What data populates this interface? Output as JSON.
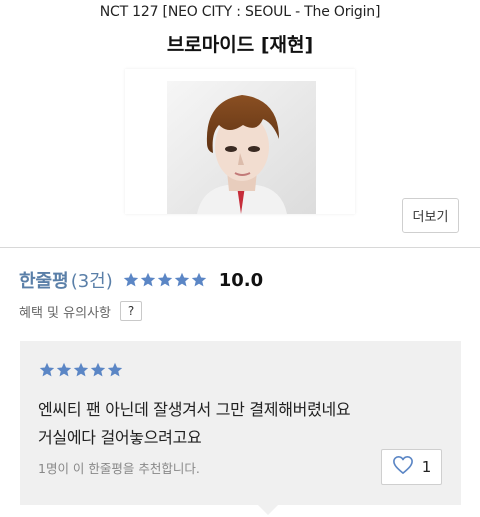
{
  "product": {
    "subtitle": "NCT 127 [NEO CITY : SEOUL - The Origin]",
    "title": "브로마이드 [재현]",
    "more_label": "더보기"
  },
  "reviews": {
    "label": "한줄평",
    "count": "(3건)",
    "rating_stars": 5,
    "score": "10.0",
    "notice_label": "혜택 및 유의사항",
    "help_label": "?",
    "star_color": "#5b86c5"
  },
  "review_item": {
    "stars": 5,
    "line1": "엔씨티 팬 아닌데 잘생겨서 그만 결제해버렸네요",
    "line2": "거실에다 걸어놓으려고요",
    "recommend_text": "1명이 이 한줄평을 추천합니다.",
    "like_count": "1",
    "heart_icon": "heart-outline-icon"
  }
}
